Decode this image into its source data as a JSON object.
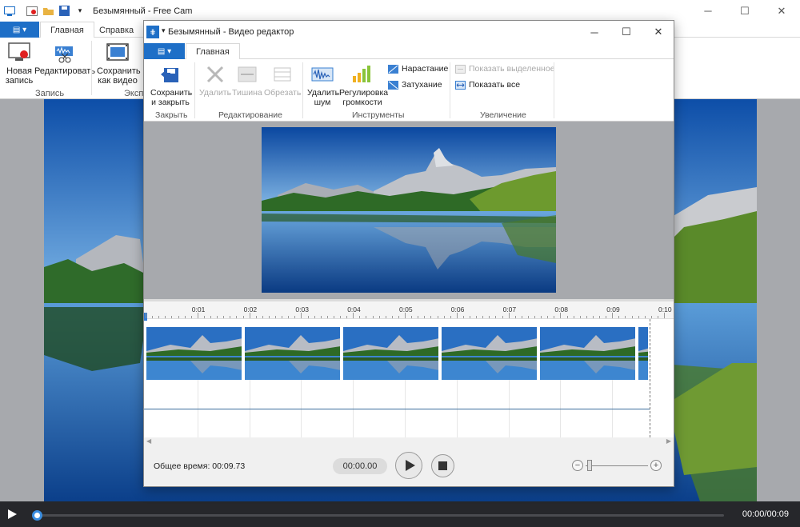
{
  "main_window": {
    "title": "Безымянный - Free Cam",
    "tabs": [
      "Главная",
      "Справка"
    ],
    "ribbon": {
      "new_record": "Новая запись",
      "edit": "Редактировать",
      "save_as_video": "Сохранить как видео",
      "group_record": "Запись",
      "group_export": "Экспо"
    },
    "player": {
      "time": "00:00/00:09",
      "progress": 0.0
    }
  },
  "editor_window": {
    "title": "Безымянный - Видео редактор",
    "tab": "Главная",
    "ribbon": {
      "save_close": "Сохранить и закрыть",
      "delete": "Удалить",
      "silence": "Тишина",
      "trim": "Обрезать",
      "remove_noise": "Удалить шум",
      "volume": "Регулировка громкости",
      "fade_in": "Нарастание",
      "fade_out": "Затухание",
      "show_selected": "Показать выделенное",
      "show_all": "Показать все",
      "group_close": "Закрыть",
      "group_edit": "Редактирование",
      "group_tools": "Инструменты",
      "group_zoom": "Увеличение"
    },
    "ruler_labels": [
      "0:01",
      "0:02",
      "0:03",
      "0:04",
      "0:05",
      "0:06",
      "0:07",
      "0:08",
      "0:09",
      "0:10"
    ],
    "total_time": "Общее время: 00:09.73",
    "current_time": "00:00.00"
  },
  "icons": [
    "app-icon",
    "record-icon",
    "folder-icon",
    "save-icon",
    "dropdown-icon",
    "new-record-icon",
    "edit-icon",
    "film-icon",
    "save-close-icon",
    "delete-icon",
    "silence-icon",
    "trim-icon",
    "noise-icon",
    "volume-icon",
    "fade-in-icon",
    "fade-out-icon",
    "show-selected-icon",
    "show-all-icon",
    "play-icon",
    "stop-icon",
    "zoom-minus-icon",
    "zoom-plus-icon"
  ],
  "colors": {
    "accent": "#1e6fc7",
    "player_bg": "#26272b",
    "workspace_bg": "#a7a9ad"
  }
}
